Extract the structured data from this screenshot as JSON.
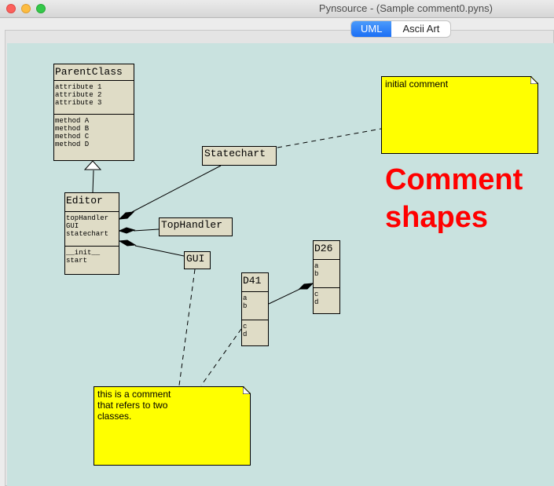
{
  "window": {
    "title": "Pynsource - (Sample comment0.pyns)"
  },
  "view_switch": {
    "uml_label": "UML",
    "ascii_label": "Ascii Art",
    "selected": "UML"
  },
  "colors": {
    "canvas_bg": "#c9e2df",
    "class_fill": "#dfdcc6",
    "note_fill": "#ffff00",
    "heading_text": "#ff0000",
    "active_tab": "#1a6ef5"
  },
  "diagram": {
    "heading": "Comment\nshapes",
    "classes": {
      "parent": {
        "name": "ParentClass",
        "attributes": [
          "attribute 1",
          "attribute 2",
          "attribute 3"
        ],
        "methods": [
          "method A",
          "method B",
          "method C",
          "method D"
        ]
      },
      "editor": {
        "name": "Editor",
        "attributes": [
          "topHandler",
          "GUI",
          "statechart"
        ],
        "methods": [
          "__init__",
          "start"
        ]
      },
      "d26": {
        "name": "D26",
        "attributes": [
          "a",
          "b"
        ],
        "methods": [
          "c",
          "d"
        ]
      },
      "d41": {
        "name": "D41",
        "attributes": [
          "a",
          "b"
        ],
        "methods": [
          "c",
          "d"
        ]
      }
    },
    "simple_boxes": {
      "statechart": "Statechart",
      "tophandler": "TopHandler",
      "gui": "GUI"
    },
    "comments": {
      "initial": "initial comment",
      "refers": "this is a comment\nthat refers to two\nclasses."
    }
  }
}
